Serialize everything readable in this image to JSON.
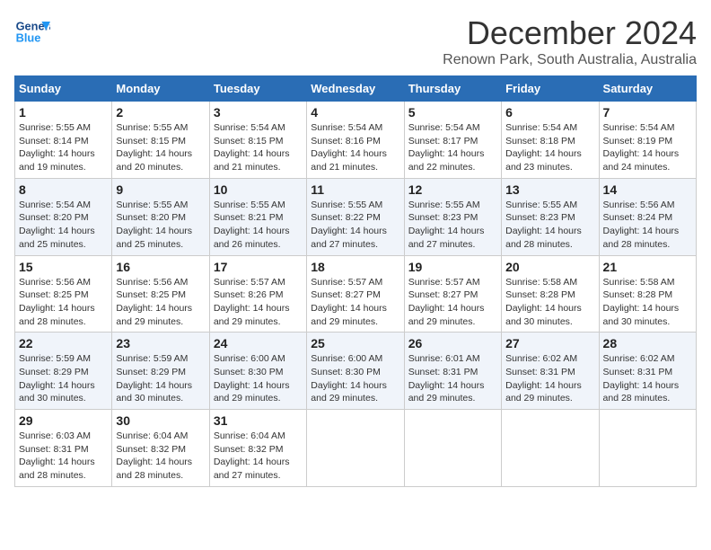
{
  "header": {
    "logo_line1": "General",
    "logo_line2": "Blue",
    "month_title": "December 2024",
    "location": "Renown Park, South Australia, Australia"
  },
  "weekdays": [
    "Sunday",
    "Monday",
    "Tuesday",
    "Wednesday",
    "Thursday",
    "Friday",
    "Saturday"
  ],
  "weeks": [
    [
      {
        "day": "1",
        "text": "Sunrise: 5:55 AM\nSunset: 8:14 PM\nDaylight: 14 hours and 19 minutes."
      },
      {
        "day": "2",
        "text": "Sunrise: 5:55 AM\nSunset: 8:15 PM\nDaylight: 14 hours and 20 minutes."
      },
      {
        "day": "3",
        "text": "Sunrise: 5:54 AM\nSunset: 8:15 PM\nDaylight: 14 hours and 21 minutes."
      },
      {
        "day": "4",
        "text": "Sunrise: 5:54 AM\nSunset: 8:16 PM\nDaylight: 14 hours and 21 minutes."
      },
      {
        "day": "5",
        "text": "Sunrise: 5:54 AM\nSunset: 8:17 PM\nDaylight: 14 hours and 22 minutes."
      },
      {
        "day": "6",
        "text": "Sunrise: 5:54 AM\nSunset: 8:18 PM\nDaylight: 14 hours and 23 minutes."
      },
      {
        "day": "7",
        "text": "Sunrise: 5:54 AM\nSunset: 8:19 PM\nDaylight: 14 hours and 24 minutes."
      }
    ],
    [
      {
        "day": "8",
        "text": "Sunrise: 5:54 AM\nSunset: 8:20 PM\nDaylight: 14 hours and 25 minutes."
      },
      {
        "day": "9",
        "text": "Sunrise: 5:55 AM\nSunset: 8:20 PM\nDaylight: 14 hours and 25 minutes."
      },
      {
        "day": "10",
        "text": "Sunrise: 5:55 AM\nSunset: 8:21 PM\nDaylight: 14 hours and 26 minutes."
      },
      {
        "day": "11",
        "text": "Sunrise: 5:55 AM\nSunset: 8:22 PM\nDaylight: 14 hours and 27 minutes."
      },
      {
        "day": "12",
        "text": "Sunrise: 5:55 AM\nSunset: 8:23 PM\nDaylight: 14 hours and 27 minutes."
      },
      {
        "day": "13",
        "text": "Sunrise: 5:55 AM\nSunset: 8:23 PM\nDaylight: 14 hours and 28 minutes."
      },
      {
        "day": "14",
        "text": "Sunrise: 5:56 AM\nSunset: 8:24 PM\nDaylight: 14 hours and 28 minutes."
      }
    ],
    [
      {
        "day": "15",
        "text": "Sunrise: 5:56 AM\nSunset: 8:25 PM\nDaylight: 14 hours and 28 minutes."
      },
      {
        "day": "16",
        "text": "Sunrise: 5:56 AM\nSunset: 8:25 PM\nDaylight: 14 hours and 29 minutes."
      },
      {
        "day": "17",
        "text": "Sunrise: 5:57 AM\nSunset: 8:26 PM\nDaylight: 14 hours and 29 minutes."
      },
      {
        "day": "18",
        "text": "Sunrise: 5:57 AM\nSunset: 8:27 PM\nDaylight: 14 hours and 29 minutes."
      },
      {
        "day": "19",
        "text": "Sunrise: 5:57 AM\nSunset: 8:27 PM\nDaylight: 14 hours and 29 minutes."
      },
      {
        "day": "20",
        "text": "Sunrise: 5:58 AM\nSunset: 8:28 PM\nDaylight: 14 hours and 30 minutes."
      },
      {
        "day": "21",
        "text": "Sunrise: 5:58 AM\nSunset: 8:28 PM\nDaylight: 14 hours and 30 minutes."
      }
    ],
    [
      {
        "day": "22",
        "text": "Sunrise: 5:59 AM\nSunset: 8:29 PM\nDaylight: 14 hours and 30 minutes."
      },
      {
        "day": "23",
        "text": "Sunrise: 5:59 AM\nSunset: 8:29 PM\nDaylight: 14 hours and 30 minutes."
      },
      {
        "day": "24",
        "text": "Sunrise: 6:00 AM\nSunset: 8:30 PM\nDaylight: 14 hours and 29 minutes."
      },
      {
        "day": "25",
        "text": "Sunrise: 6:00 AM\nSunset: 8:30 PM\nDaylight: 14 hours and 29 minutes."
      },
      {
        "day": "26",
        "text": "Sunrise: 6:01 AM\nSunset: 8:31 PM\nDaylight: 14 hours and 29 minutes."
      },
      {
        "day": "27",
        "text": "Sunrise: 6:02 AM\nSunset: 8:31 PM\nDaylight: 14 hours and 29 minutes."
      },
      {
        "day": "28",
        "text": "Sunrise: 6:02 AM\nSunset: 8:31 PM\nDaylight: 14 hours and 28 minutes."
      }
    ],
    [
      {
        "day": "29",
        "text": "Sunrise: 6:03 AM\nSunset: 8:31 PM\nDaylight: 14 hours and 28 minutes."
      },
      {
        "day": "30",
        "text": "Sunrise: 6:04 AM\nSunset: 8:32 PM\nDaylight: 14 hours and 28 minutes."
      },
      {
        "day": "31",
        "text": "Sunrise: 6:04 AM\nSunset: 8:32 PM\nDaylight: 14 hours and 27 minutes."
      },
      {
        "day": "",
        "text": ""
      },
      {
        "day": "",
        "text": ""
      },
      {
        "day": "",
        "text": ""
      },
      {
        "day": "",
        "text": ""
      }
    ]
  ]
}
